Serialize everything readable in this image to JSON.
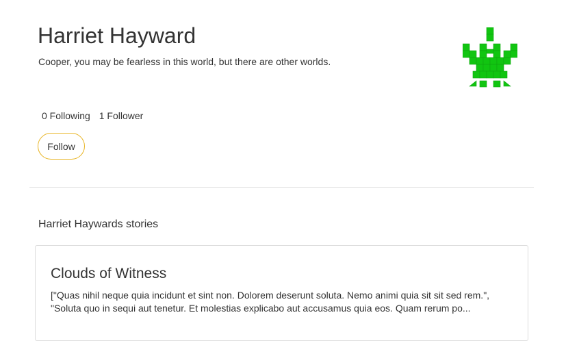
{
  "profile": {
    "name": "Harriet Hayward",
    "bio": "Cooper, you may be fearless in this world, but there are other worlds.",
    "avatar_icon": "pixel-invader-icon",
    "avatar_color": "#11c511"
  },
  "stats": {
    "following": "0 Following",
    "followers": "1 Follower"
  },
  "follow_button": {
    "label": "Follow",
    "border_color": "#e8b423"
  },
  "stories_section": {
    "title": "Harriet Haywards stories"
  },
  "stories": [
    {
      "title": "Clouds of Witness",
      "excerpt": "[\"Quas nihil neque quia incidunt et sint non. Dolorem deserunt soluta. Nemo animi quia sit sit sed rem.\", \"Soluta quo in sequi aut tenetur. Et molestias explicabo aut accusamus quia eos. Quam rerum po..."
    }
  ]
}
